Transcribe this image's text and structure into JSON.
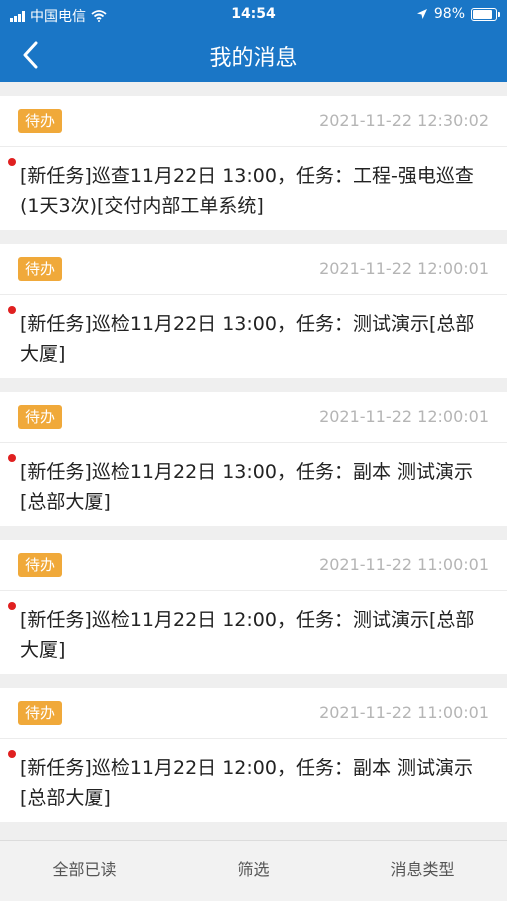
{
  "status_bar": {
    "carrier": "中国电信",
    "time": "14:54",
    "battery": "98%",
    "icons": [
      "signal-icon",
      "wifi-icon",
      "location-arrow-icon",
      "battery-icon"
    ]
  },
  "nav": {
    "title": "我的消息",
    "back_icon": "back-chevron-icon"
  },
  "messages": [
    {
      "badge": "待办",
      "time": "2021-11-22 12:30:02",
      "content": "[新任务]巡查11月22日 13:00，任务：工程-强电巡查(1天3次)[交付内部工单系统]",
      "unread": true
    },
    {
      "badge": "待办",
      "time": "2021-11-22 12:00:01",
      "content": "[新任务]巡检11月22日 13:00，任务：测试演示[总部大厦]",
      "unread": true
    },
    {
      "badge": "待办",
      "time": "2021-11-22 12:00:01",
      "content": "[新任务]巡检11月22日 13:00，任务：副本 测试演示[总部大厦]",
      "unread": true
    },
    {
      "badge": "待办",
      "time": "2021-11-22 11:00:01",
      "content": "[新任务]巡检11月22日 12:00，任务：测试演示[总部大厦]",
      "unread": true
    },
    {
      "badge": "待办",
      "time": "2021-11-22 11:00:01",
      "content": "[新任务]巡检11月22日 12:00，任务：副本 测试演示[总部大厦]",
      "unread": true
    }
  ],
  "toolbar": {
    "mark_all_read": "全部已读",
    "filter": "筛选",
    "message_type": "消息类型"
  },
  "colors": {
    "header_blue": "#1a76c6",
    "badge_orange": "#f0a93a",
    "unread_dot": "#e02020"
  }
}
